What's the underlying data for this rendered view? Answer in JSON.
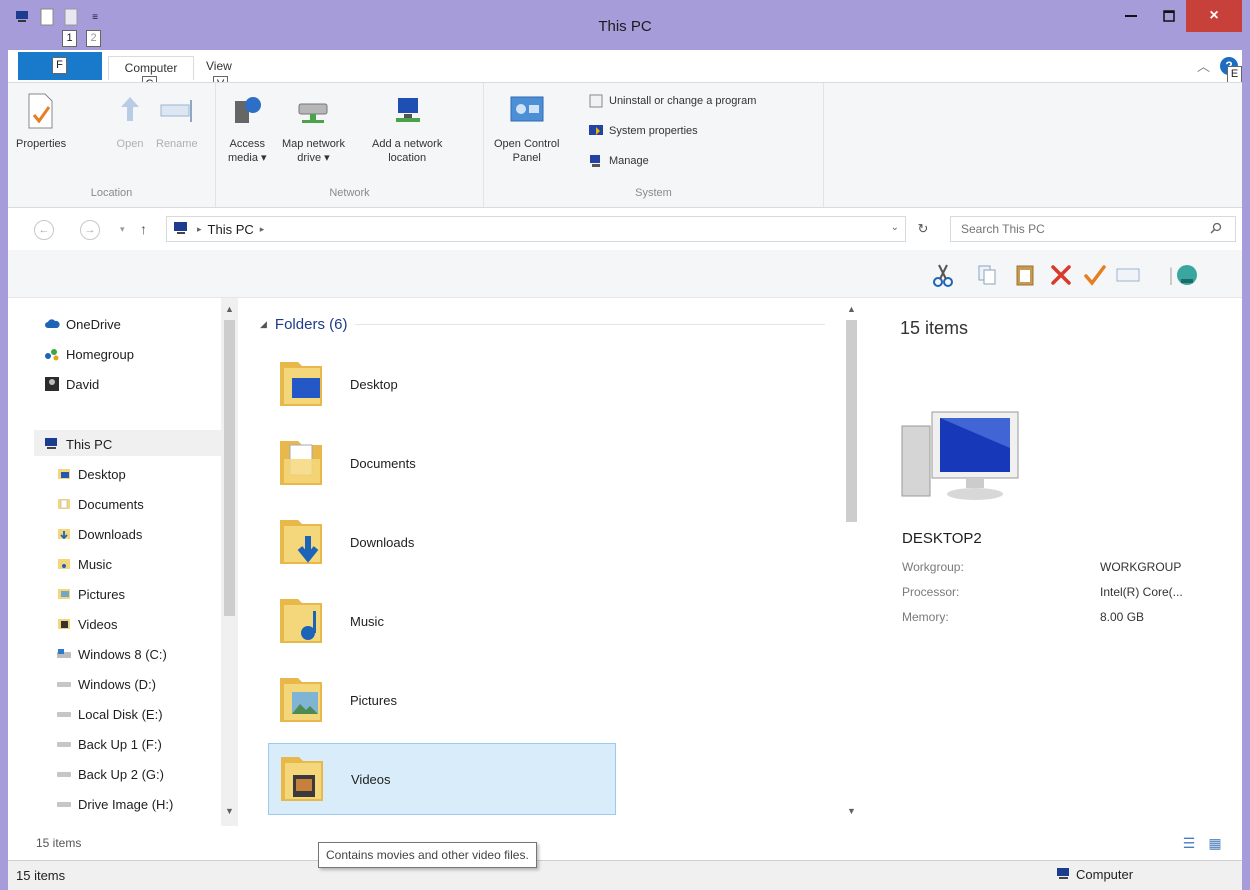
{
  "window": {
    "title": "This PC"
  },
  "title_bar": {
    "keytips": [
      "1",
      "2"
    ],
    "close_glyph": "×"
  },
  "ribbon": {
    "tabs": {
      "file_keytip": "F",
      "computer": "Computer",
      "computer_keytip": "C",
      "view": "View",
      "view_keytip": "V",
      "help_keytip": "E"
    },
    "location": {
      "label": "Location",
      "properties": "Properties",
      "open": "Open",
      "rename": "Rename"
    },
    "network": {
      "label": "Network",
      "access_media_1": "Access",
      "access_media_2": "media ▾",
      "map_drive_1": "Map network",
      "map_drive_2": "drive ▾",
      "add_location_1": "Add a network",
      "add_location_2": "location"
    },
    "system": {
      "label": "System",
      "open_cp_1": "Open Control",
      "open_cp_2": "Panel",
      "uninstall": "Uninstall or change a program",
      "sys_props": "System properties",
      "manage": "Manage"
    }
  },
  "address_bar": {
    "path": "This PC",
    "search_placeholder": "Search This PC"
  },
  "nav": {
    "items": [
      {
        "label": "OneDrive",
        "icon": "cloud-icon"
      },
      {
        "label": "Homegroup",
        "icon": "homegroup-icon"
      },
      {
        "label": "David",
        "icon": "user-icon"
      },
      {
        "label": "This PC",
        "icon": "computer-icon"
      },
      {
        "label": "Desktop",
        "icon": "desktop-folder-icon"
      },
      {
        "label": "Documents",
        "icon": "documents-folder-icon"
      },
      {
        "label": "Downloads",
        "icon": "downloads-folder-icon"
      },
      {
        "label": "Music",
        "icon": "music-folder-icon"
      },
      {
        "label": "Pictures",
        "icon": "pictures-folder-icon"
      },
      {
        "label": "Videos",
        "icon": "videos-folder-icon"
      },
      {
        "label": "Windows 8 (C:)",
        "icon": "system-drive-icon"
      },
      {
        "label": "Windows (D:)",
        "icon": "drive-icon"
      },
      {
        "label": "Local Disk (E:)",
        "icon": "drive-icon"
      },
      {
        "label": "Back Up 1 (F:)",
        "icon": "drive-icon"
      },
      {
        "label": "Back Up 2 (G:)",
        "icon": "drive-icon"
      },
      {
        "label": "Drive Image (H:)",
        "icon": "drive-icon"
      }
    ]
  },
  "content": {
    "group": "Folders (6)",
    "folders": [
      {
        "name": "Desktop",
        "icon": "desktop-folder-icon"
      },
      {
        "name": "Documents",
        "icon": "documents-folder-icon"
      },
      {
        "name": "Downloads",
        "icon": "downloads-folder-icon"
      },
      {
        "name": "Music",
        "icon": "music-folder-icon"
      },
      {
        "name": "Pictures",
        "icon": "pictures-folder-icon"
      },
      {
        "name": "Videos",
        "icon": "videos-folder-icon"
      }
    ],
    "selected": "Videos"
  },
  "details": {
    "count": "15 items",
    "computer_name": "DESKTOP2",
    "properties": [
      {
        "label": "Workgroup:",
        "value": "WORKGROUP"
      },
      {
        "label": "Processor:",
        "value": "Intel(R) Core(..."
      },
      {
        "label": "Memory:",
        "value": "8.00 GB"
      }
    ]
  },
  "status": {
    "inner": "15 items",
    "outer": "15 items",
    "zone": "Computer"
  },
  "tooltip": "Contains movies and other video files.",
  "colors": {
    "title_bar": "#a59cd9",
    "file_tab": "#1979ca",
    "close_button": "#c7403a",
    "selection": "#d9ecfa",
    "folder": "#f5d77b"
  }
}
